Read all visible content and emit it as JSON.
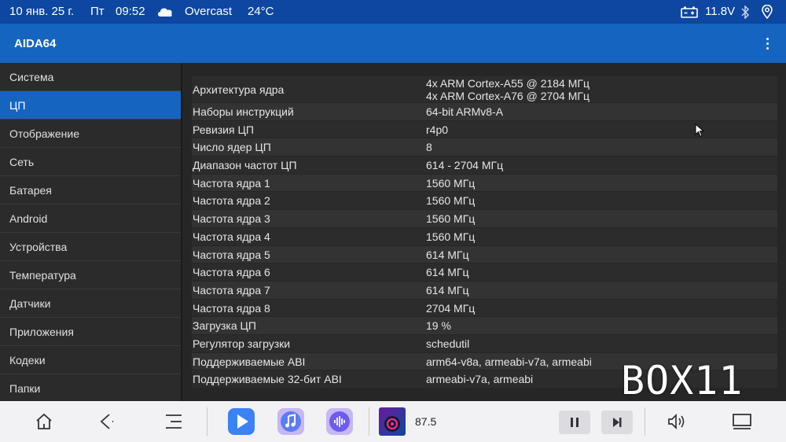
{
  "status_bar": {
    "date": "10 янв. 25 г.",
    "weekday": "Пт",
    "time": "09:52",
    "weather": "Overcast",
    "temperature": "24°C",
    "voltage": "11.8V",
    "icons": [
      "cloud-icon",
      "battery-icon",
      "bluetooth-icon",
      "location-icon"
    ]
  },
  "app_bar": {
    "title": "AIDA64",
    "overflow_icon": "more-vert-icon"
  },
  "sidebar": {
    "items": [
      {
        "label": "Система"
      },
      {
        "label": "ЦП"
      },
      {
        "label": "Отображение"
      },
      {
        "label": "Сеть"
      },
      {
        "label": "Батарея"
      },
      {
        "label": "Android"
      },
      {
        "label": "Устройства"
      },
      {
        "label": "Температура"
      },
      {
        "label": "Датчики"
      },
      {
        "label": "Приложения"
      },
      {
        "label": "Кодеки"
      },
      {
        "label": "Папки"
      }
    ],
    "active_index": 1
  },
  "cpu_table": {
    "rows": [
      {
        "label": "Архитектура ядра",
        "value": "4x ARM Cortex-A55 @ 2184 МГц",
        "value2": "4x ARM Cortex-A76 @ 2704 МГц"
      },
      {
        "label": "Наборы инструкций",
        "value": "64-bit ARMv8-A"
      },
      {
        "label": "Ревизия ЦП",
        "value": "r4p0"
      },
      {
        "label": "Число ядер ЦП",
        "value": "8"
      },
      {
        "label": "Диапазон частот ЦП",
        "value": "614 - 2704 МГц"
      },
      {
        "label": "Частота ядра 1",
        "value": "1560 МГц"
      },
      {
        "label": "Частота ядра 2",
        "value": "1560 МГц"
      },
      {
        "label": "Частота ядра 3",
        "value": "1560 МГц"
      },
      {
        "label": "Частота ядра 4",
        "value": "1560 МГц"
      },
      {
        "label": "Частота ядра 5",
        "value": "614 МГц"
      },
      {
        "label": "Частота ядра 6",
        "value": "614 МГц"
      },
      {
        "label": "Частота ядра 7",
        "value": "614 МГц"
      },
      {
        "label": "Частота ядра 8",
        "value": "2704 МГц"
      },
      {
        "label": "Загрузка ЦП",
        "value": "19 %"
      },
      {
        "label": "Регулятор загрузки",
        "value": "schedutil"
      },
      {
        "label": "Поддерживаемые ABI",
        "value": "arm64-v8a, armeabi-v7a, armeabi"
      },
      {
        "label": "Поддерживаемые 32-бит ABI",
        "value": "armeabi-v7a, armeabi"
      }
    ]
  },
  "watermark": "BOX11",
  "bottom_bar": {
    "radio_frequency": "87.5",
    "icons": [
      "home-icon",
      "back-icon",
      "menu-icon",
      "video-player-icon",
      "music-app-icon",
      "voice-app-icon",
      "radio-cover-icon",
      "pause-icon",
      "next-track-icon",
      "volume-icon",
      "screen-icon"
    ]
  },
  "colors": {
    "status_bar": "#0d47a1",
    "app_bar": "#1565c0",
    "accent": "#1565c0",
    "content_bg": "#262626",
    "bottom_bar": "#f2f2f4"
  }
}
